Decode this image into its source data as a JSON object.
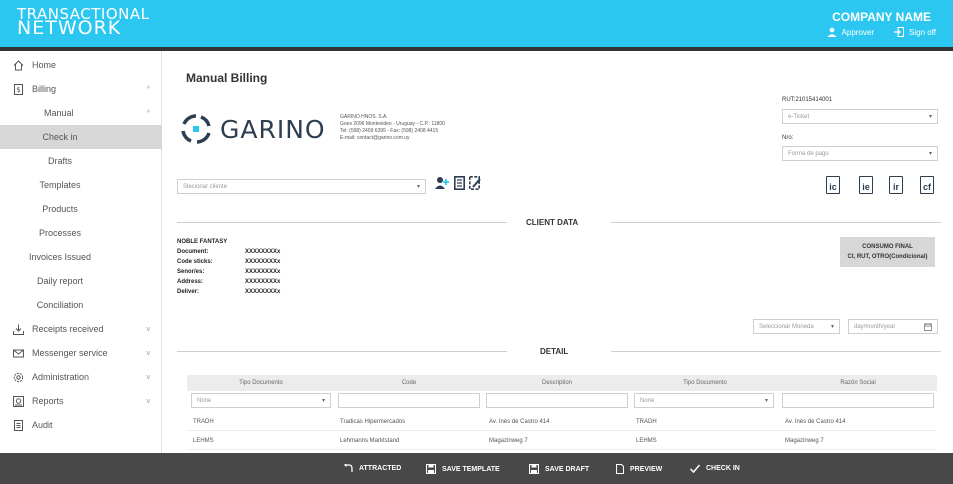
{
  "header": {
    "brand_line1": "TRANSACTIONAL",
    "brand_line2": "NETWORK",
    "company": "COMPANY NAME",
    "approver": "Approver",
    "signoff": "Sign off"
  },
  "sidebar": {
    "items": [
      {
        "label": "Home",
        "icon": "home-icon"
      },
      {
        "label": "Billing",
        "icon": "billing-icon",
        "chev": "^"
      },
      {
        "label": "Manual",
        "chev": "^"
      },
      {
        "label": "Check in"
      },
      {
        "label": "Drafts"
      },
      {
        "label": "Templates"
      },
      {
        "label": "Products"
      },
      {
        "label": "Processes"
      },
      {
        "label": "Invoices Issued"
      },
      {
        "label": "Daily report"
      },
      {
        "label": "Conciliation"
      },
      {
        "label": "Receipts received",
        "icon": "download-icon",
        "chev": "v"
      },
      {
        "label": "Messenger service",
        "icon": "mail-icon",
        "chev": "v"
      },
      {
        "label": "Administration",
        "icon": "gear-icon",
        "chev": "v"
      },
      {
        "label": "Reports",
        "icon": "report-icon",
        "chev": "v"
      },
      {
        "label": "Audit",
        "icon": "audit-icon"
      }
    ]
  },
  "main": {
    "title": "Manual Billing",
    "logo_text": "GARINO",
    "company_info": [
      "GARINO HNOS. S.A.",
      "Goes 2096 Montevideo - Uruguay - C.P.: 11800",
      "Tel: (598) 2409 6395 - Fax: (598) 2408 4415",
      "E-mail: contact@garino.com.uy"
    ],
    "rut": "RUT:21015414001",
    "ticket_select": "e-Ticket",
    "nro_label": "Nro:",
    "payment_select": "Forma de pago",
    "client_select": "Slecionar cliente",
    "doc_buttons": [
      "ic",
      "ie",
      "ir",
      "cf"
    ],
    "client_data_title": "CLIENT DATA",
    "client": {
      "name": "NOBLE FANTASY",
      "fields": [
        {
          "k": "Document:",
          "v": "XXXXXXXXx"
        },
        {
          "k": "Code sticks:",
          "v": "XXXXXXXXx"
        },
        {
          "k": "Senor/es:",
          "v": "XXXXXXXXx"
        },
        {
          "k": "Address:",
          "v": "XXXXXXXXx"
        },
        {
          "k": "Deliver:",
          "v": "XXXXXXXXx"
        }
      ]
    },
    "consumo_line1": "CONSUMO FINAL",
    "consumo_line2": "CI, RUT, OTRO(Condicional)",
    "currency_select": "Seleccionar Moneda",
    "date_placeholder": "day/month/year",
    "detail_title": "DETAIL",
    "table": {
      "headers": [
        "Tipo Documento",
        "Code",
        "Description",
        "Tipo Documento",
        "Razón Social"
      ],
      "filter_none": "None",
      "rows": [
        [
          "TRADH",
          "Tradicas Hipermercados",
          "Av. Inés de Castro 414",
          "TRADH",
          "Av. Inés de Castro 414"
        ],
        [
          "LEHMS",
          "Lehmanns Marktstand",
          "Magazinweg 7",
          "LEHMS",
          "Magazinweg 7"
        ]
      ]
    }
  },
  "actions": {
    "attracted": "ATTRACTED",
    "save_template": "SAVE TEMPLATE",
    "save_draft": "SAVE DRAFT",
    "preview": "PREVIEW",
    "check_in": "CHECK IN"
  },
  "colors": {
    "topbar": "#2cc7f0",
    "bottombar": "#484848",
    "active_nav": "#d7d7d7"
  }
}
